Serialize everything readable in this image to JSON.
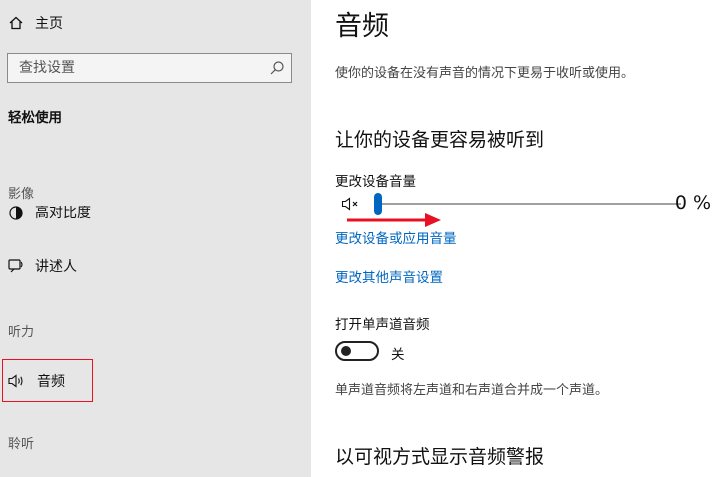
{
  "sidebar": {
    "home_label": "主页",
    "search_placeholder": "查找设置",
    "category_title": "轻松使用",
    "sections": {
      "vision": "影像",
      "hearing": "听力",
      "interaction": "聆听"
    },
    "items": [
      {
        "label": "高对比度",
        "icon": "contrast-icon"
      },
      {
        "label": "讲述人",
        "icon": "narrator-icon"
      },
      {
        "label": "音频",
        "icon": "speaker-icon",
        "selected": true
      }
    ],
    "highlight_color": "#e81123"
  },
  "main": {
    "title": "音频",
    "description": "使你的设备在没有声音的情况下更易于收听或使用。",
    "section1_title": "让你的设备更容易被听到",
    "volume_label": "更改设备音量",
    "volume_value": "0 %",
    "volume_level": 0,
    "mute_icon": "speaker-mute-icon",
    "link_app_volume": "更改设备或应用音量",
    "link_other_sound": "更改其他声音设置",
    "mono_label": "打开单声道音频",
    "mono_state_label": "关",
    "mono_on": false,
    "mono_description": "单声道音频将左声道和右声道合并成一个声道。",
    "section2_title": "以可视方式显示音频警报"
  },
  "colors": {
    "accent": "#0067c0",
    "annotation_arrow": "#e81123"
  }
}
